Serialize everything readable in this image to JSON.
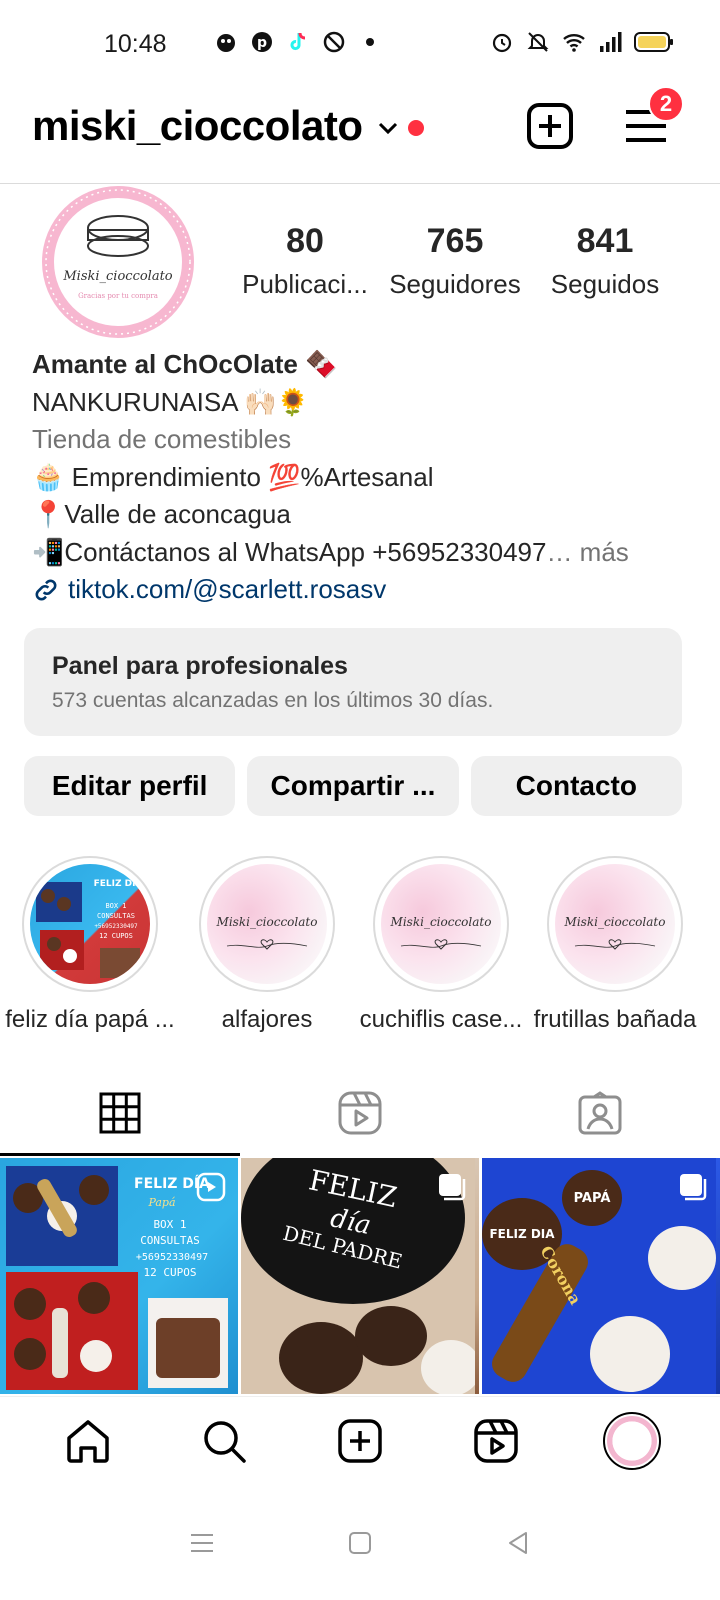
{
  "status_bar": {
    "time": "10:48",
    "left_icons": [
      "app-icon",
      "pinterest-icon",
      "tiktok-icon",
      "blocked-icon",
      "dot-icon"
    ],
    "right_icons": [
      "alarm-icon",
      "mute-icon",
      "wifi-icon",
      "signal-icon",
      "battery-icon"
    ]
  },
  "header": {
    "username": "miski_cioccolato",
    "notification_count": "2",
    "accent_color": "#ff3040"
  },
  "profile": {
    "stats": [
      {
        "value": "80",
        "label": "Publicaci..."
      },
      {
        "value": "765",
        "label": "Seguidores"
      },
      {
        "value": "841",
        "label": "Seguidos"
      }
    ],
    "bio": {
      "name_line": "Amante al ChOcOlate 🍫",
      "line2": "NANKURUNAISA 🙌🏻🌻",
      "category": "Tienda de comestibles",
      "line3": "🧁 Emprendimiento 💯%Artesanal",
      "line4": "📍Valle de aconcagua",
      "line5": "📲Contáctanos  al WhatsApp +56952330497",
      "more": "… más",
      "link": "tiktok.com/@scarlett.rosasv"
    },
    "avatar_text": "Miski_cioccolato",
    "avatar_subtext": "Gracias por tu compra"
  },
  "pro_panel": {
    "title": "Panel para profesionales",
    "subtitle": "573 cuentas alcanzadas en los últimos 30 días."
  },
  "buttons": {
    "edit": "Editar perfil",
    "share": "Compartir ...",
    "contact": "Contacto"
  },
  "highlights": [
    {
      "label": "feliz día papá ...",
      "cover_text": "Miski_cioccolato"
    },
    {
      "label": "alfajores",
      "cover_text": "Miski_cioccolato"
    },
    {
      "label": "cuchiflis case...",
      "cover_text": "Miski_cioccolato"
    },
    {
      "label": "frutillas bañada",
      "cover_text": "Miski_cioccolato"
    }
  ],
  "post_texts": {
    "post1_title": "FELIZ DÍA",
    "post1_sub": "Papá",
    "post1_lines": [
      "BOX 1",
      "CONSULTAS",
      "+56952330497",
      "12 CUPOS"
    ],
    "post2_lines": [
      "FELIZ",
      "día",
      "DEL PADRE"
    ],
    "post3_words": [
      "FELIZ DIA",
      "PAPÁ",
      "Corona"
    ]
  },
  "tabs": [
    "grid-tab",
    "reels-tab",
    "tagged-tab"
  ],
  "bottom_nav": [
    "home",
    "search",
    "create",
    "reels",
    "profile"
  ]
}
